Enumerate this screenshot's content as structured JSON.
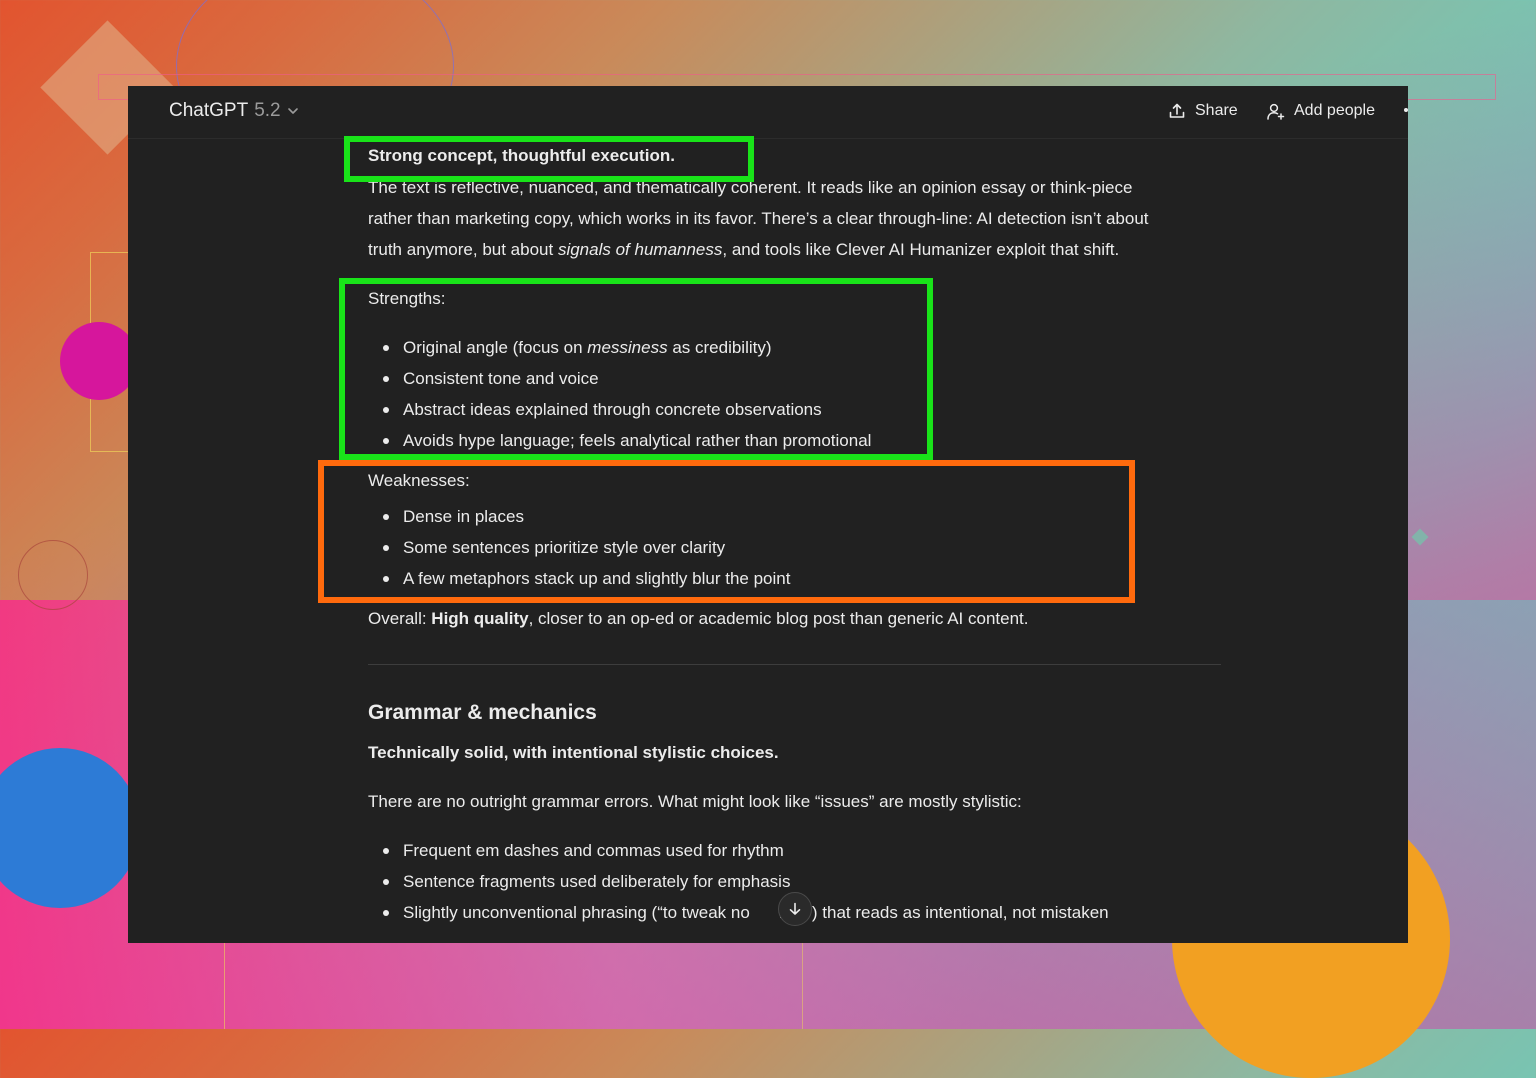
{
  "header": {
    "model_name": "ChatGPT",
    "model_version": "5.2",
    "share_label": "Share",
    "add_people_label": "Add people"
  },
  "section1": {
    "heading": "Strong concept, thoughtful execution.",
    "para_line1": "The text is reflective, nuanced, and thematically coherent. It reads like an opinion essay or think-piece",
    "para_line2": "rather than marketing copy, which works in its favor. There’s a clear through-line: AI detection isn’t about",
    "para_line3_pre": "truth anymore, but about ",
    "para_line3_em": "signals of humanness",
    "para_line3_post": ", and tools like Clever AI Humanizer exploit that shift."
  },
  "strengths": {
    "label": "Strengths:",
    "item1_pre": "Original angle (focus on ",
    "item1_em": "messiness",
    "item1_post": " as credibility)",
    "item2": "Consistent tone and voice",
    "item3": "Abstract ideas explained through concrete observations",
    "item4": "Avoids hype language; feels analytical rather than promotional"
  },
  "weaknesses": {
    "label": "Weaknesses:",
    "items": [
      "Dense in places",
      "Some sentences prioritize style over clarity",
      "A few metaphors stack up and slightly blur the point"
    ]
  },
  "overall": {
    "pre": "Overall: ",
    "bold": "High quality",
    "post": ", closer to an op-ed or academic blog post than generic AI content."
  },
  "grammar": {
    "title": "Grammar & mechanics",
    "subtitle": "Technically solid, with intentional stylistic choices.",
    "intro": "There are no outright grammar errors. What might look like “issues” are mostly stylistic:",
    "item1": "Frequent em dashes and commas used for rhythm",
    "item2": "Sentence fragments used deliberately for emphasis",
    "item3_pre": "Slightly unconventional phrasing (“to tweak no",
    "item3_post": "nse”) that reads as intentional, not mistaken"
  },
  "colors": {
    "window_bg": "#212121",
    "text": "#ececec",
    "highlight_green": "#19e319",
    "highlight_orange": "#ff6a0d"
  },
  "icons": {
    "share": "share-upload-icon",
    "add_people": "add-person-icon",
    "scroll": "arrow-down-icon",
    "model_menu": "chevron-down-icon"
  }
}
